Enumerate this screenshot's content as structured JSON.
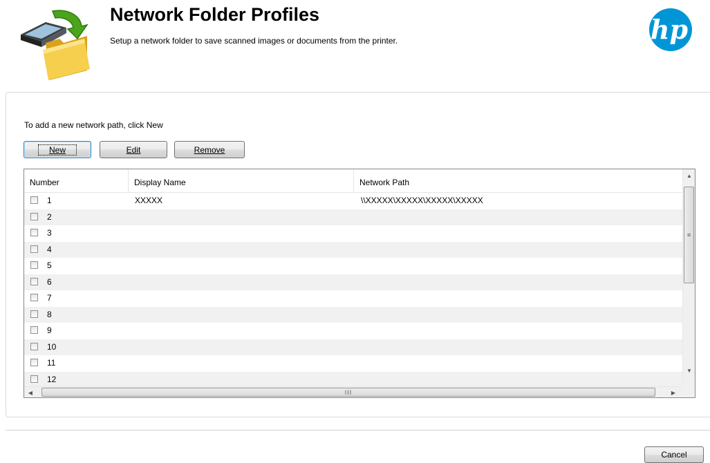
{
  "header": {
    "title": "Network Folder Profiles",
    "subtitle": "Setup a network folder to save scanned images or documents from the printer.",
    "app_icon": "scan-to-folder-icon",
    "logo_text": "hp"
  },
  "instructions": "To add a new network path, click New",
  "toolbar": {
    "new_label": "New",
    "edit_label": "Edit",
    "remove_label": "Remove"
  },
  "list": {
    "columns": [
      "Number",
      "Display Name",
      "Network Path"
    ],
    "rows": [
      {
        "number": "1",
        "display_name": "XXXXX",
        "network_path": "\\\\XXXXX\\XXXXX\\XXXXX\\XXXXX",
        "checked": false
      },
      {
        "number": "2",
        "display_name": "",
        "network_path": "",
        "checked": false
      },
      {
        "number": "3",
        "display_name": "",
        "network_path": "",
        "checked": false
      },
      {
        "number": "4",
        "display_name": "",
        "network_path": "",
        "checked": false
      },
      {
        "number": "5",
        "display_name": "",
        "network_path": "",
        "checked": false
      },
      {
        "number": "6",
        "display_name": "",
        "network_path": "",
        "checked": false
      },
      {
        "number": "7",
        "display_name": "",
        "network_path": "",
        "checked": false
      },
      {
        "number": "8",
        "display_name": "",
        "network_path": "",
        "checked": false
      },
      {
        "number": "9",
        "display_name": "",
        "network_path": "",
        "checked": false
      },
      {
        "number": "10",
        "display_name": "",
        "network_path": "",
        "checked": false
      },
      {
        "number": "11",
        "display_name": "",
        "network_path": "",
        "checked": false
      },
      {
        "number": "12",
        "display_name": "",
        "network_path": "",
        "checked": false
      }
    ]
  },
  "footer": {
    "cancel_label": "Cancel"
  },
  "colors": {
    "hp_blue": "#0096d6",
    "default_button_border": "#3c7fb1",
    "alt_row": "#f1f1f1"
  }
}
